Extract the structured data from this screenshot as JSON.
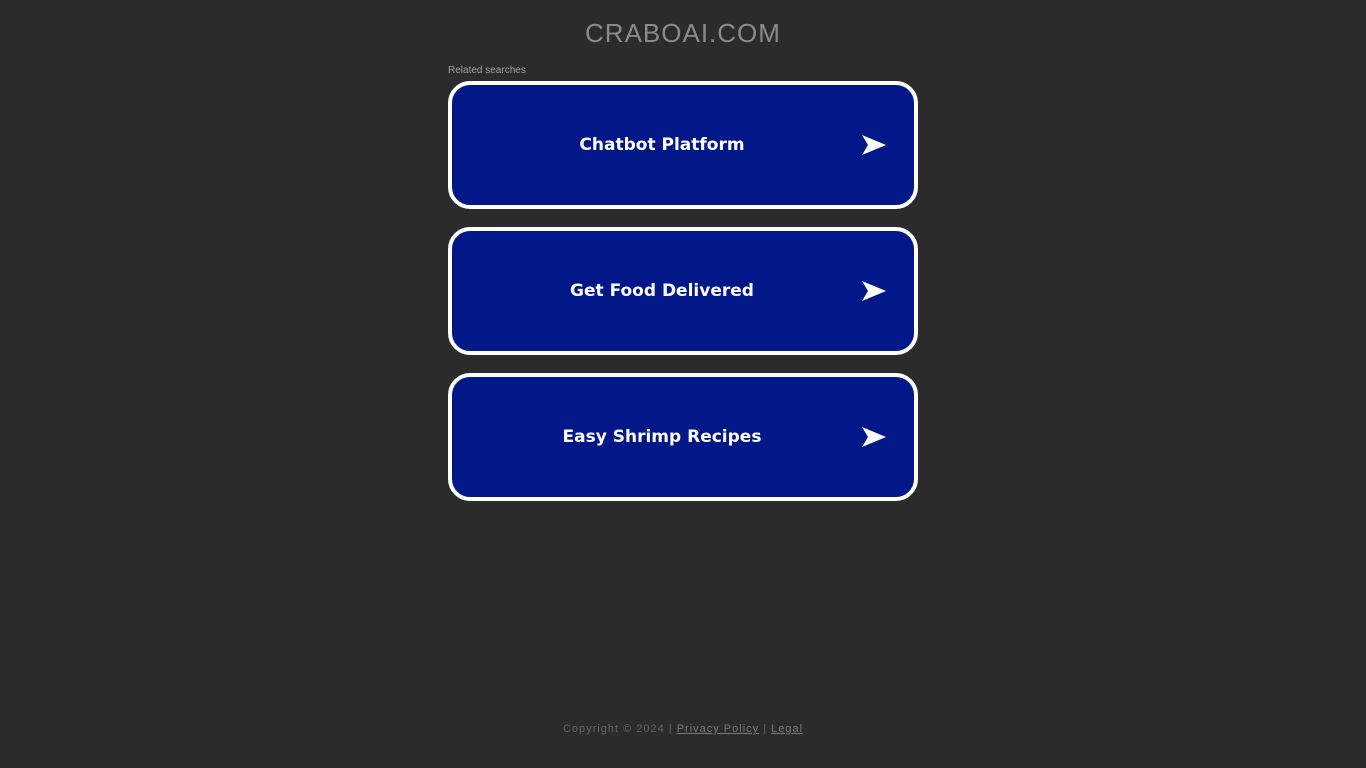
{
  "header": {
    "domain": "CRABOAI.COM"
  },
  "related": {
    "label": "Related searches",
    "links": [
      {
        "label": "Chatbot Platform"
      },
      {
        "label": "Get Food Delivered"
      },
      {
        "label": "Easy Shrimp Recipes"
      }
    ]
  },
  "footer": {
    "copyright": "Copyright © 2024",
    "separator": "|",
    "privacy": "Privacy Policy",
    "legal": "Legal"
  },
  "colors": {
    "background": "#2b2b2b",
    "button": "#021889",
    "button_border": "#ffffff"
  },
  "icons": {
    "arrow": "arrow-right-icon"
  }
}
